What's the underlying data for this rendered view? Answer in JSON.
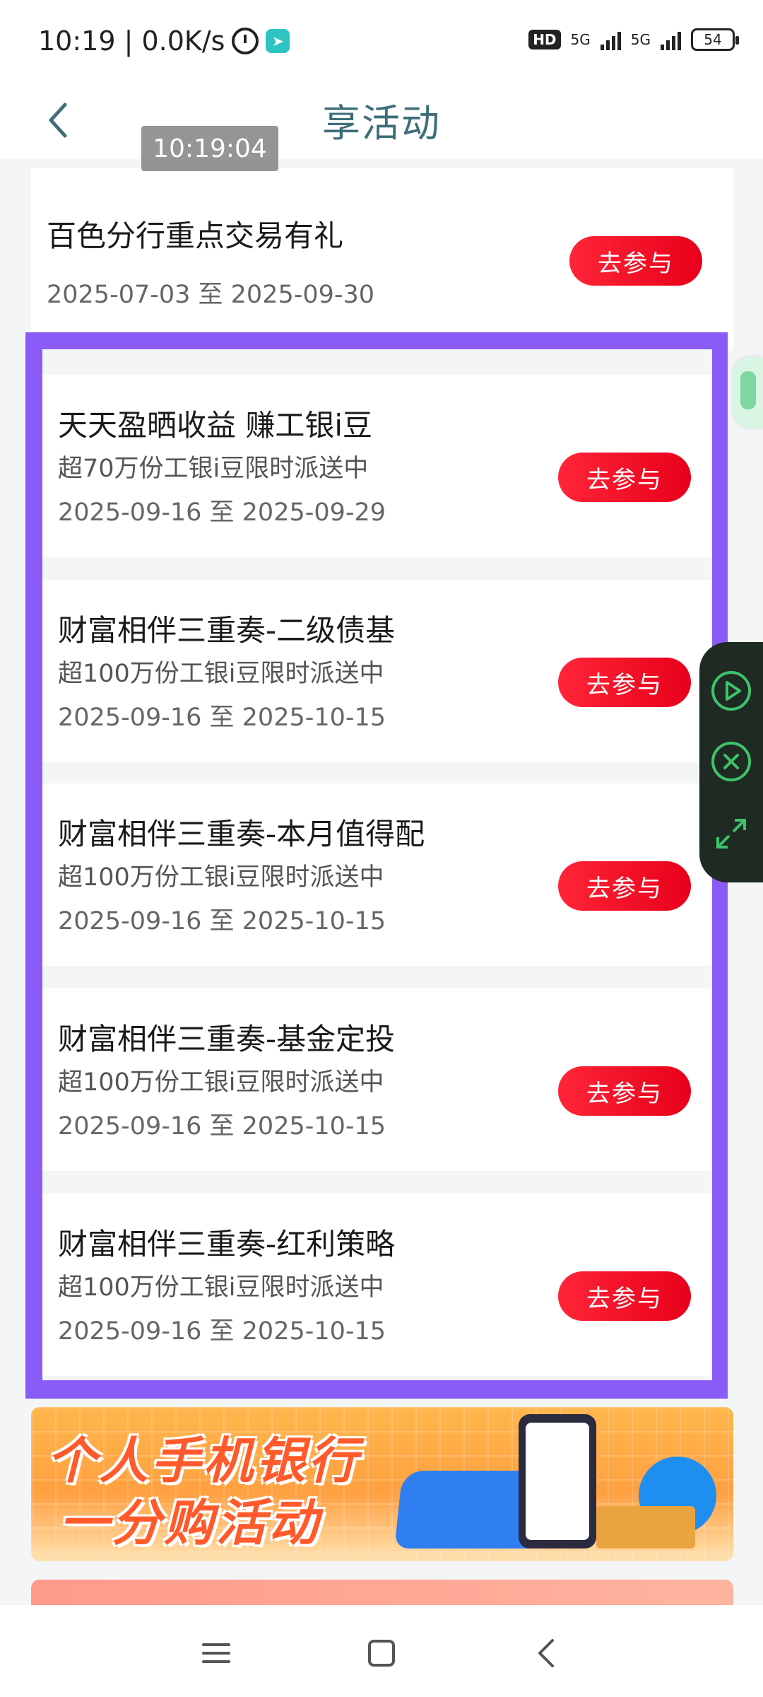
{
  "status_bar": {
    "time_speed": "10:19 | 0.0K/s",
    "network1": "5G",
    "network2": "5G",
    "hd_label": "HD",
    "battery": "54"
  },
  "header": {
    "title": "享活动",
    "back_icon": "chevron-left-icon"
  },
  "overlay": {
    "timestamp": "10:19:04"
  },
  "activities": [
    {
      "title": "百色分行重点交易有礼",
      "subtitle": "",
      "date": "2025-07-03 至 2025-09-30",
      "button": "去参与"
    },
    {
      "title": "天天盈晒收益 赚工银i豆",
      "subtitle": "超70万份工银i豆限时派送中",
      "date": "2025-09-16 至 2025-09-29",
      "button": "去参与"
    },
    {
      "title": "财富相伴三重奏-二级债基",
      "subtitle": "超100万份工银i豆限时派送中",
      "date": "2025-09-16 至 2025-10-15",
      "button": "去参与"
    },
    {
      "title": "财富相伴三重奏-本月值得配",
      "subtitle": "超100万份工银i豆限时派送中",
      "date": "2025-09-16 至 2025-10-15",
      "button": "去参与"
    },
    {
      "title": "财富相伴三重奏-基金定投",
      "subtitle": "超100万份工银i豆限时派送中",
      "date": "2025-09-16 至 2025-10-15",
      "button": "去参与"
    },
    {
      "title": "财富相伴三重奏-红利策略",
      "subtitle": "超100万份工银i豆限时派送中",
      "date": "2025-09-16 至 2025-10-15",
      "button": "去参与"
    }
  ],
  "banner": {
    "line1": "个人手机银行",
    "line2": "一分购活动"
  },
  "colors": {
    "accent_button": "#e8001a",
    "highlight_border": "#8a5cf7",
    "title_color": "#3d6e7a"
  },
  "nav": {
    "menu_icon": "menu-icon",
    "home_icon": "home-square-icon",
    "back_icon": "back-icon"
  }
}
